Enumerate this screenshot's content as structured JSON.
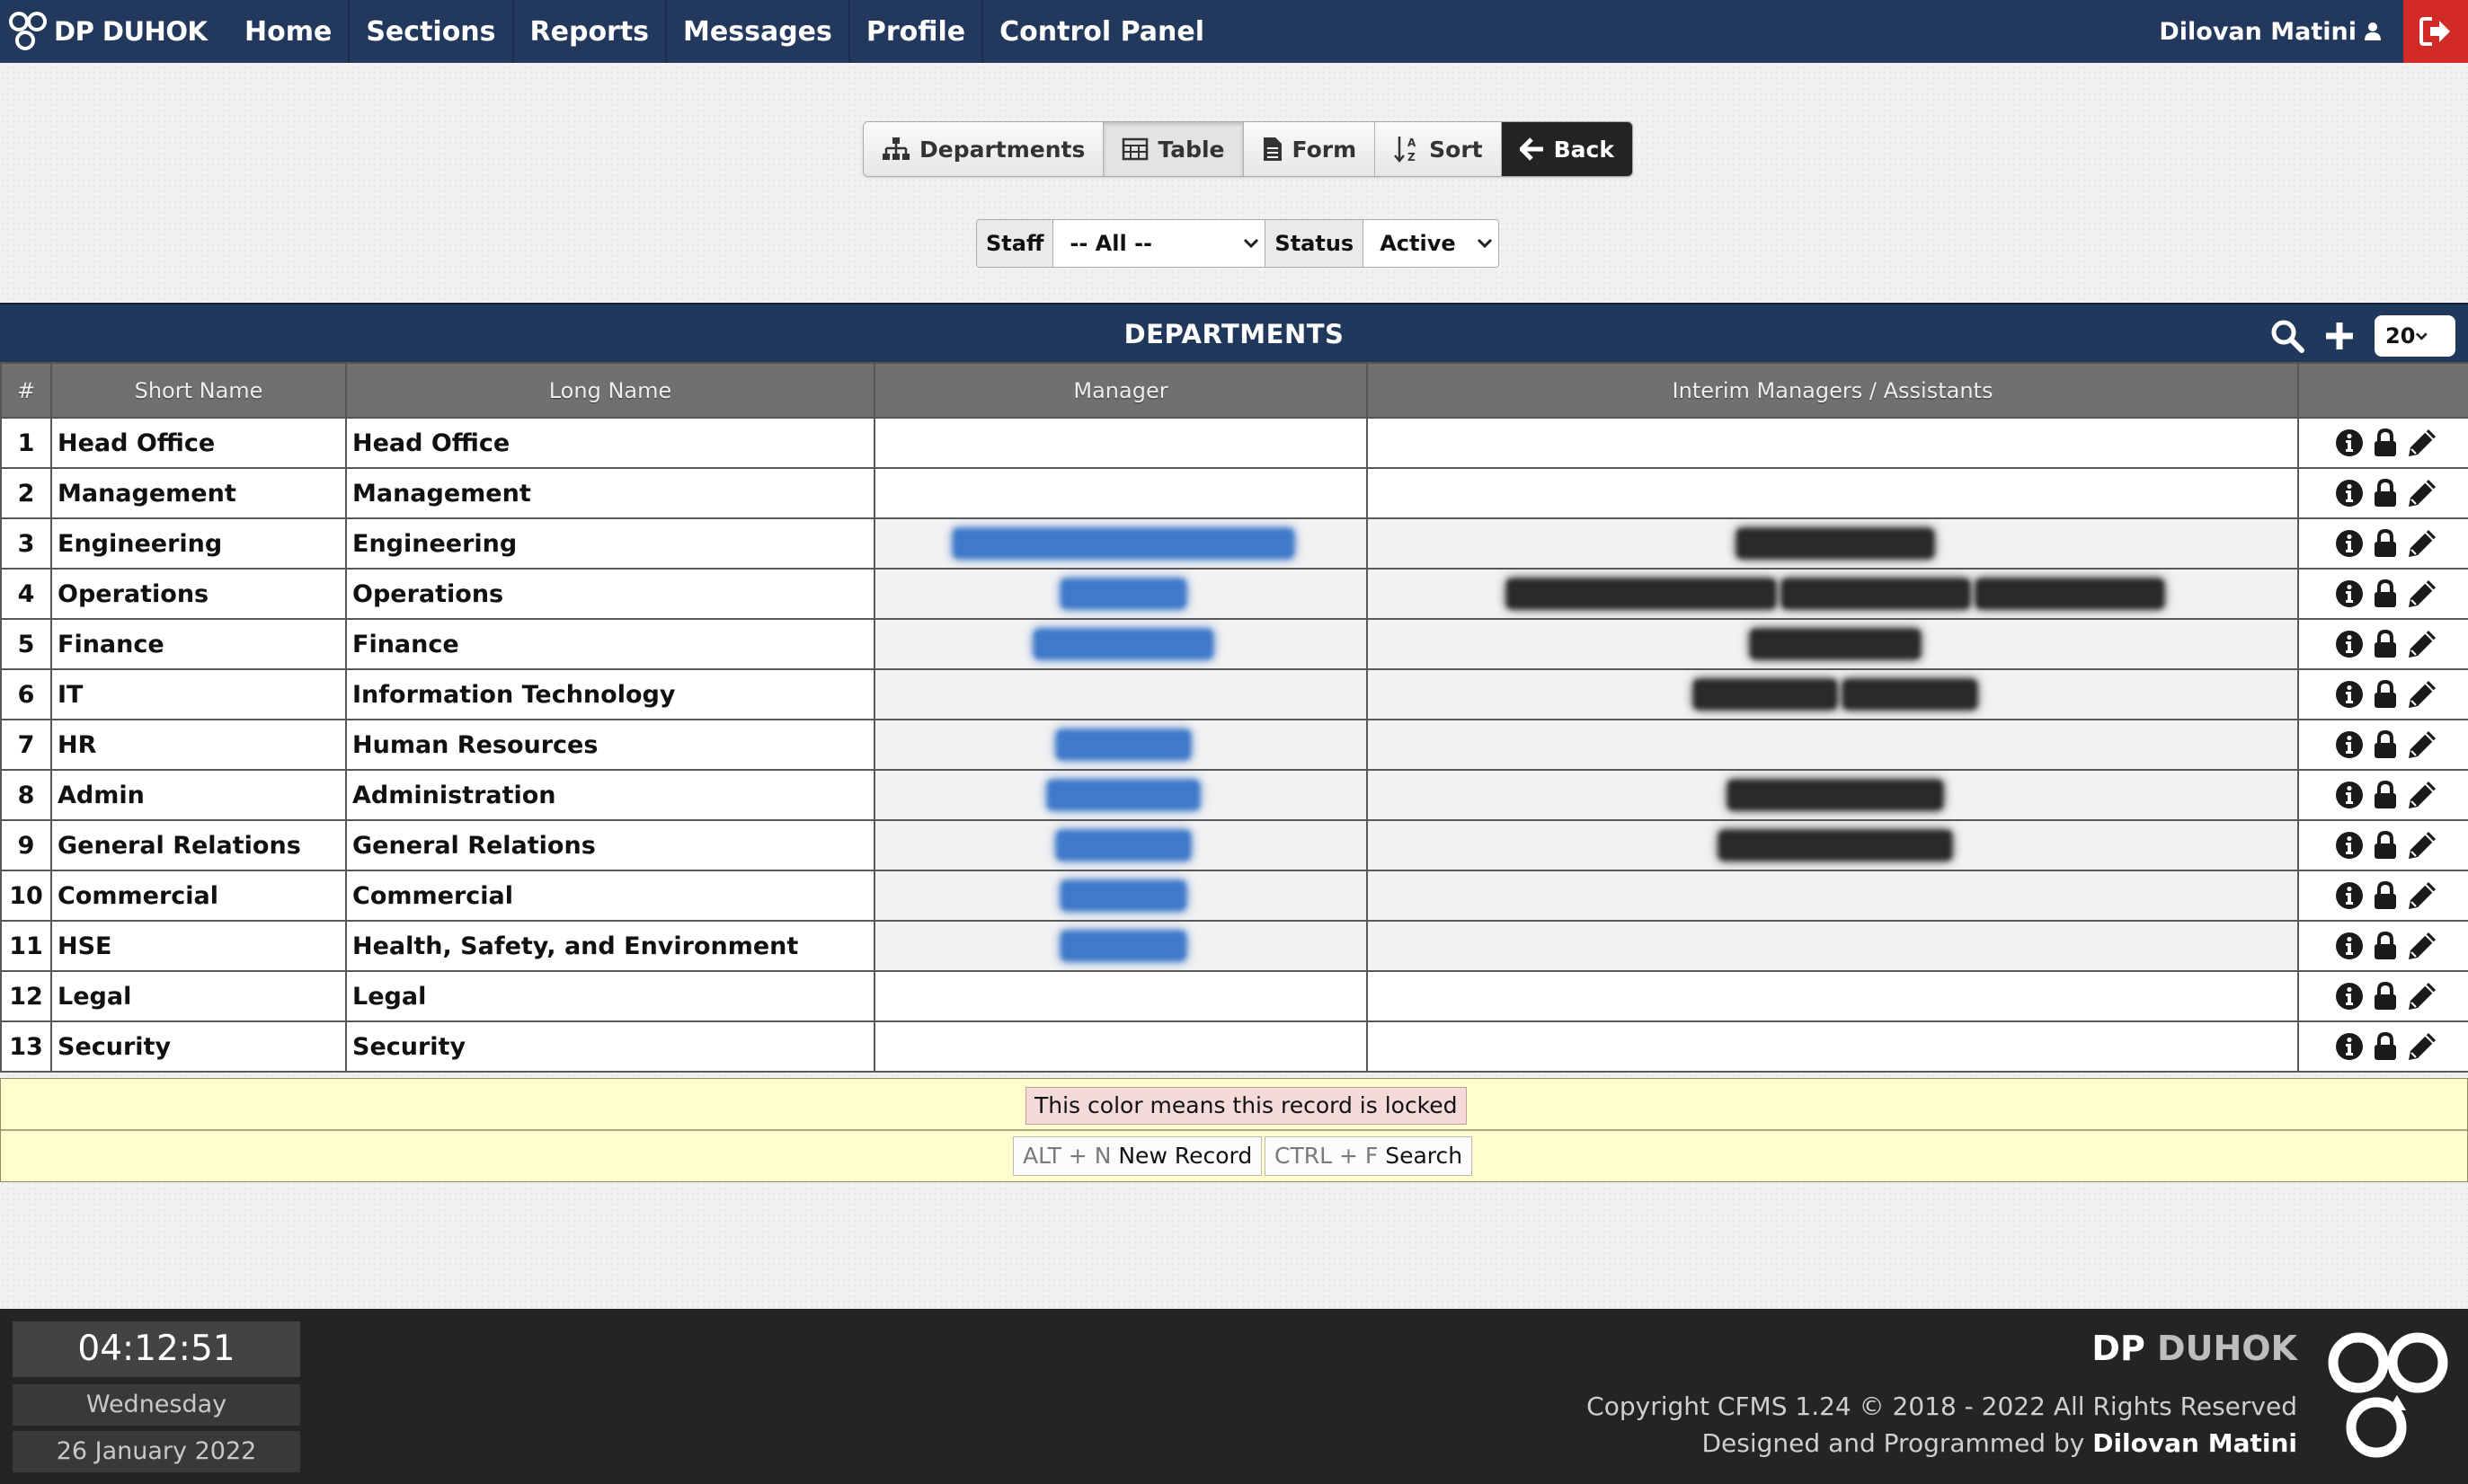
{
  "brand": {
    "name": "DP DUHOK"
  },
  "nav": [
    {
      "label": "Home"
    },
    {
      "label": "Sections"
    },
    {
      "label": "Reports"
    },
    {
      "label": "Messages"
    },
    {
      "label": "Profile"
    },
    {
      "label": "Control Panel"
    }
  ],
  "user": {
    "name": "Dilovan Matini"
  },
  "toolbar": {
    "departments": "Departments",
    "table": "Table",
    "form": "Form",
    "sort": "Sort",
    "back": "Back"
  },
  "filter": {
    "staff_label": "Staff",
    "staff_value": "-- All --",
    "status_label": "Status",
    "status_value": "Active"
  },
  "panel": {
    "title": "DEPARTMENTS",
    "page_size": "20"
  },
  "table": {
    "headers": [
      "#",
      "Short Name",
      "Long Name",
      "Manager",
      "Interim Managers / Assistants",
      ""
    ],
    "rows": [
      {
        "num": "1",
        "short": "Head Office",
        "long": "Head Office"
      },
      {
        "num": "2",
        "short": "Management",
        "long": "Management"
      },
      {
        "num": "3",
        "short": "Engineering",
        "long": "Engineering"
      },
      {
        "num": "4",
        "short": "Operations",
        "long": "Operations"
      },
      {
        "num": "5",
        "short": "Finance",
        "long": "Finance"
      },
      {
        "num": "6",
        "short": "IT",
        "long": "Information Technology"
      },
      {
        "num": "7",
        "short": "HR",
        "long": "Human Resources"
      },
      {
        "num": "8",
        "short": "Admin",
        "long": "Administration"
      },
      {
        "num": "9",
        "short": "General Relations",
        "long": "General Relations"
      },
      {
        "num": "10",
        "short": "Commercial",
        "long": "Commercial"
      },
      {
        "num": "11",
        "short": "HSE",
        "long": "Health, Safety, and Environment"
      },
      {
        "num": "12",
        "short": "Legal",
        "long": "Legal"
      },
      {
        "num": "13",
        "short": "Security",
        "long": "Security"
      }
    ]
  },
  "legend": {
    "locked_note": "This color means this record is locked",
    "new_key": "ALT + N",
    "new_label": "New Record",
    "search_key": "CTRL + F",
    "search_label": "Search"
  },
  "footer": {
    "time": "04:12:51",
    "day": "Wednesday",
    "date": "26 January 2022",
    "brand_part1": "DP",
    "brand_part2": "DUHOK",
    "copyright": "Copyright CFMS 1.24 © 2018 - 2022 All Rights Reserved",
    "designed_prefix": "Designed and Programmed by",
    "designer": "Dilovan Matini"
  }
}
